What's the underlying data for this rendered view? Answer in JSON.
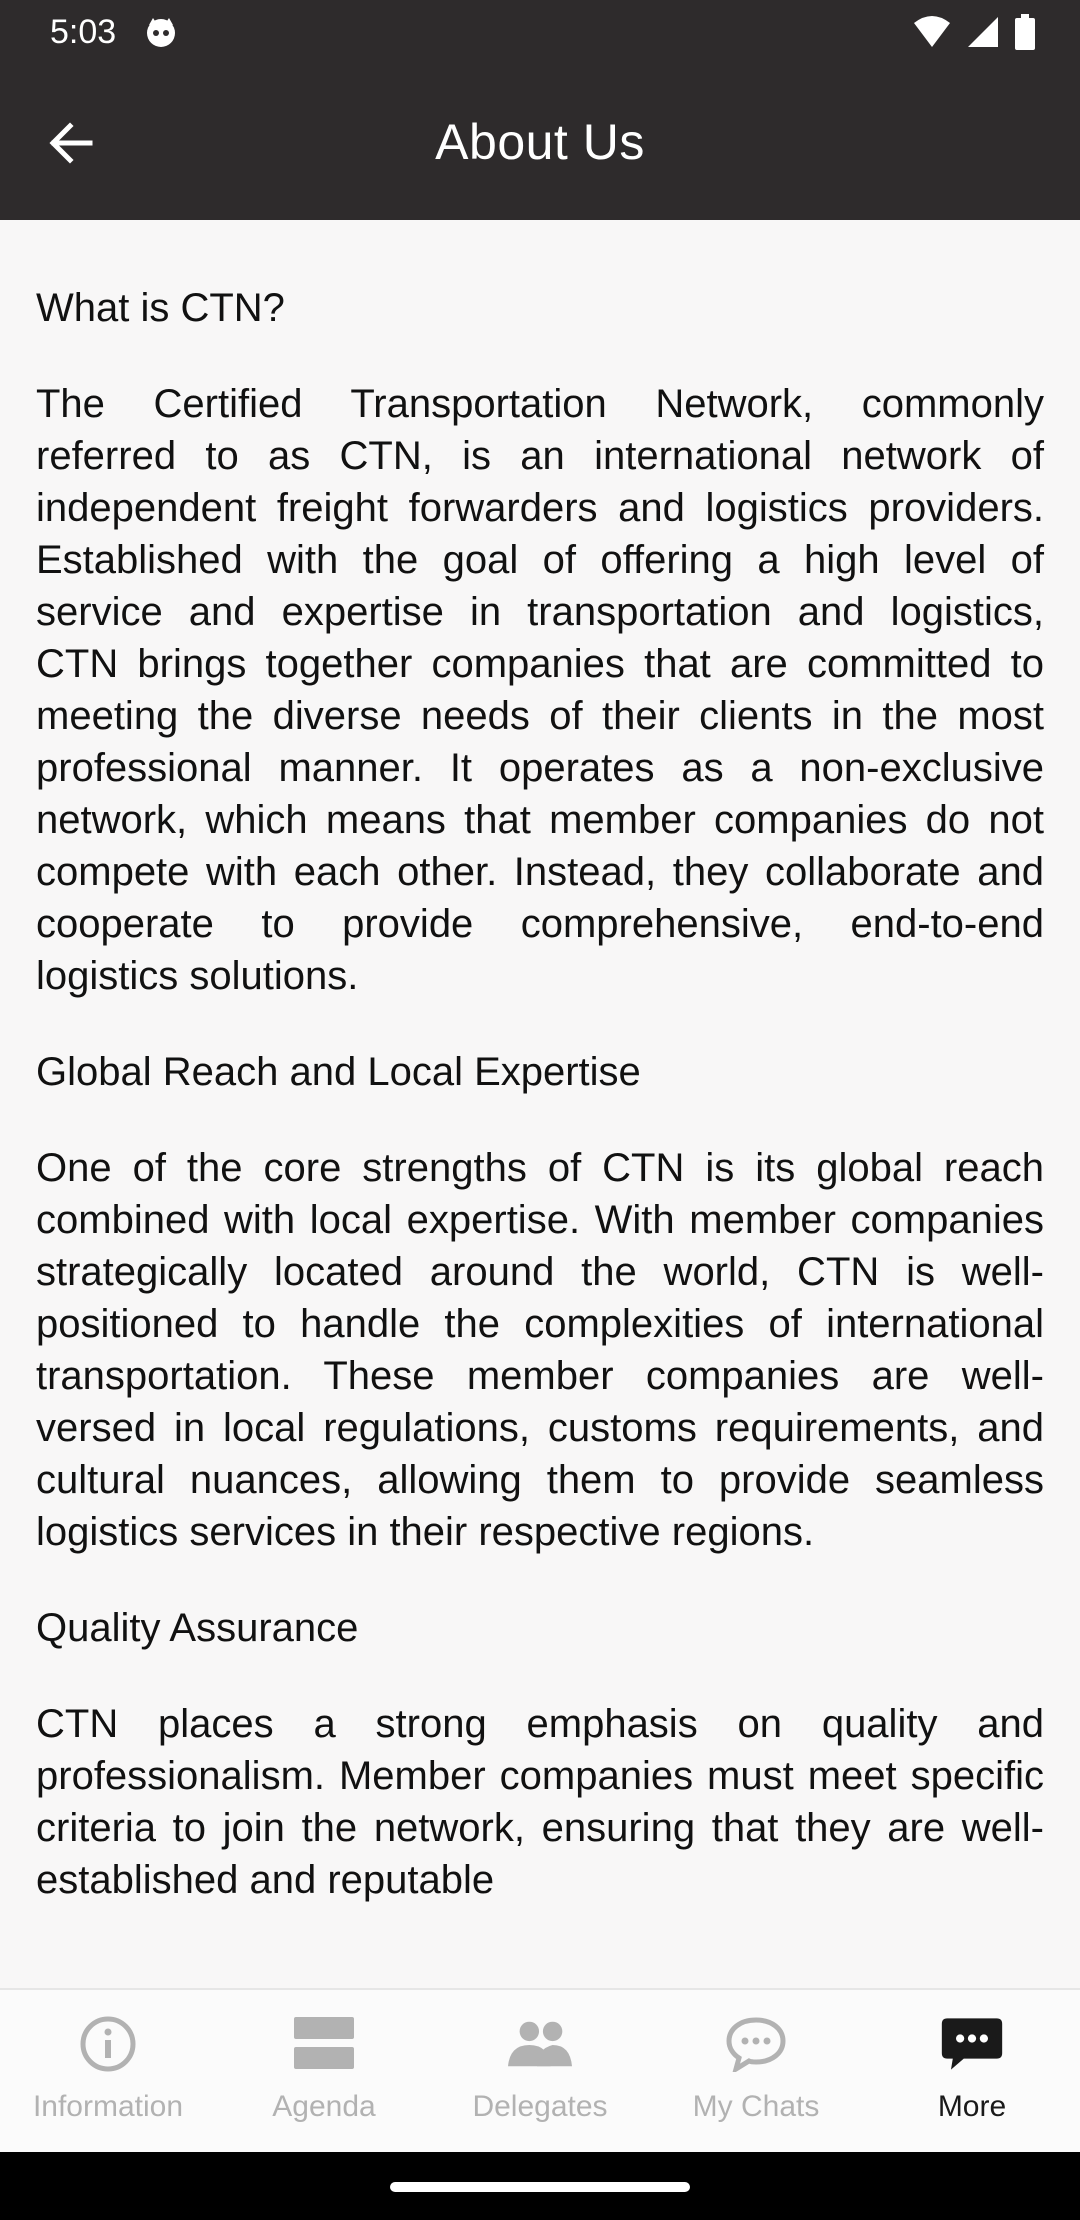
{
  "status": {
    "time": "5:03"
  },
  "appbar": {
    "title": "About Us"
  },
  "content": {
    "sections": [
      {
        "heading": "What is CTN?",
        "body": "The Certified Transportation Network, commonly referred to as CTN, is an international network of independent freight forwarders and logistics providers. Established with the goal of offering a high level of service and expertise in transportation and logistics, CTN brings together companies that are committed to meeting the diverse needs of their clients in the most professional manner. It operates as a non-exclusive network, which means that member companies do not compete with each other. Instead, they collaborate and cooperate to provide comprehensive, end-to-end logistics solutions."
      },
      {
        "heading": "Global Reach and Local Expertise",
        "body": "One of the core strengths of CTN is its global reach combined with local expertise. With member companies strategically located around the world, CTN is well-positioned to handle the complexities of international transportation. These member companies are well-versed in local regulations, customs requirements, and cultural nuances, allowing them to provide seamless logistics services in their respective regions."
      },
      {
        "heading": "Quality Assurance",
        "body": "CTN places a strong emphasis on quality and professionalism. Member companies must meet specific criteria to join the network, ensuring that they are well-established and reputable"
      }
    ]
  },
  "bottom_nav": {
    "items": [
      {
        "label": "Information",
        "icon": "info-icon",
        "active": false
      },
      {
        "label": "Agenda",
        "icon": "agenda-icon",
        "active": false
      },
      {
        "label": "Delegates",
        "icon": "delegates-icon",
        "active": false
      },
      {
        "label": "My Chats",
        "icon": "chat-icon",
        "active": false
      },
      {
        "label": "More",
        "icon": "more-icon",
        "active": true
      }
    ]
  },
  "colors": {
    "appbar_bg": "#2e2b2c",
    "page_bg": "#f8f7f7",
    "nav_inactive": "#b2b2b2",
    "nav_active": "#1a1a1a"
  }
}
